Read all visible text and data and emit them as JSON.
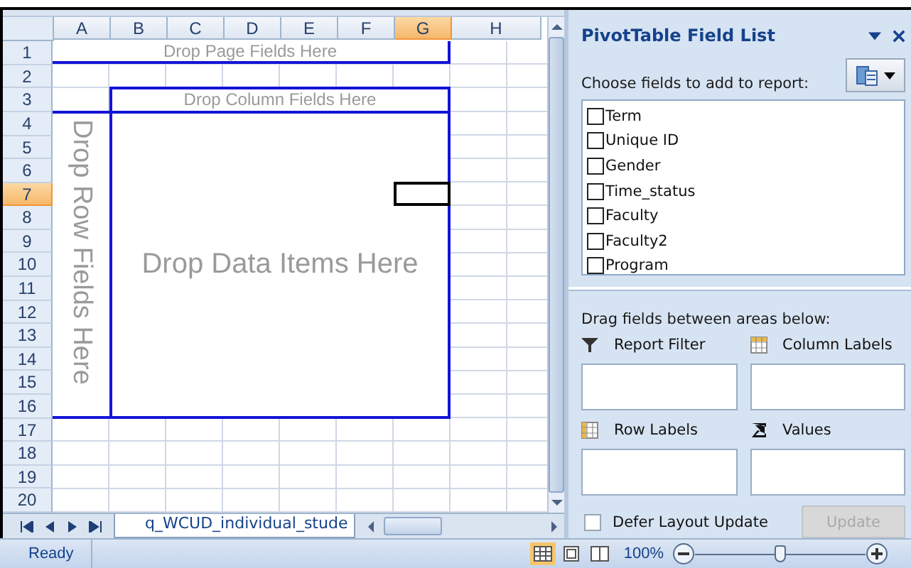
{
  "sheet": {
    "columns": [
      {
        "label": "A",
        "selected": false
      },
      {
        "label": "B",
        "selected": false
      },
      {
        "label": "C",
        "selected": false
      },
      {
        "label": "D",
        "selected": false
      },
      {
        "label": "E",
        "selected": false
      },
      {
        "label": "F",
        "selected": false
      },
      {
        "label": "G",
        "selected": true
      },
      {
        "label": "H",
        "selected": false
      }
    ],
    "rows": [
      {
        "label": "1",
        "selected": false
      },
      {
        "label": "2",
        "selected": false
      },
      {
        "label": "3",
        "selected": false
      },
      {
        "label": "4",
        "selected": false
      },
      {
        "label": "5",
        "selected": false
      },
      {
        "label": "6",
        "selected": false
      },
      {
        "label": "7",
        "selected": true
      },
      {
        "label": "8",
        "selected": false
      },
      {
        "label": "9",
        "selected": false
      },
      {
        "label": "10",
        "selected": false
      },
      {
        "label": "11",
        "selected": false
      },
      {
        "label": "12",
        "selected": false
      },
      {
        "label": "13",
        "selected": false
      },
      {
        "label": "14",
        "selected": false
      },
      {
        "label": "15",
        "selected": false
      },
      {
        "label": "16",
        "selected": false
      },
      {
        "label": "17",
        "selected": false
      },
      {
        "label": "18",
        "selected": false
      },
      {
        "label": "19",
        "selected": false
      },
      {
        "label": "20",
        "selected": false
      }
    ],
    "drop_zones": {
      "page": "Drop Page Fields Here",
      "column": "Drop Column Fields Here",
      "row": "Drop Row Fields Here",
      "data": "Drop Data Items Here"
    },
    "sheet_tab": "q_WCUD_individual_stude"
  },
  "field_list": {
    "title": "PivotTable Field List",
    "prompt": "Choose fields to add to report:",
    "fields": [
      {
        "name": "Term",
        "checked": false
      },
      {
        "name": "Unique ID",
        "checked": false
      },
      {
        "name": "Gender",
        "checked": false
      },
      {
        "name": "Time_status",
        "checked": false
      },
      {
        "name": "Faculty",
        "checked": false
      },
      {
        "name": "Faculty2",
        "checked": false
      },
      {
        "name": "Program",
        "checked": false
      }
    ],
    "areas_prompt": "Drag fields between areas below:",
    "areas": [
      {
        "kind": "filter",
        "label": "Report Filter"
      },
      {
        "kind": "columns",
        "label": "Column Labels"
      },
      {
        "kind": "rows",
        "label": "Row Labels"
      },
      {
        "kind": "values",
        "label": "Values"
      }
    ],
    "defer": {
      "label": "Defer Layout Update",
      "checked": false
    },
    "update": {
      "label": "Update",
      "disabled": true
    }
  },
  "status_bar": {
    "status": "Ready",
    "zoom": "100%",
    "zoom_slider": {
      "level": 0.5
    }
  }
}
